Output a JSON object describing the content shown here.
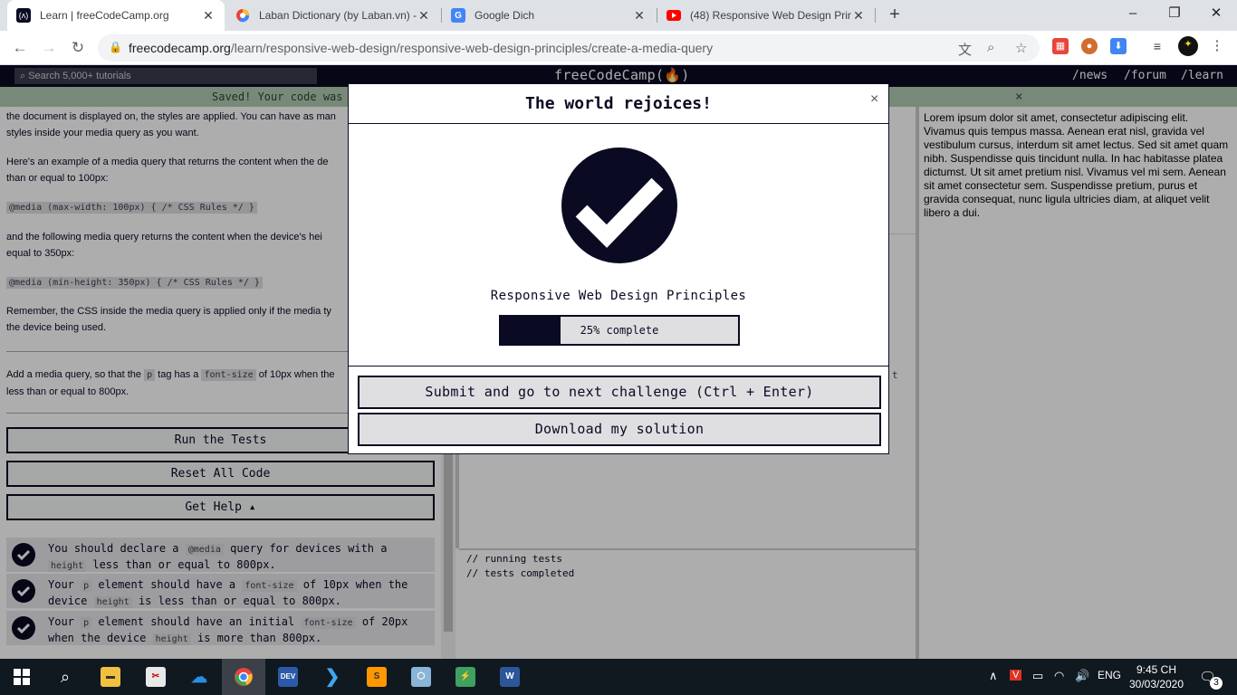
{
  "browser": {
    "tabs": [
      {
        "title": "Learn | freeCodeCamp.org",
        "close": "✕"
      },
      {
        "title": "Laban Dictionary (by Laban.vn) -",
        "close": "✕"
      },
      {
        "title": "Google Dich",
        "close": "✕"
      },
      {
        "title": "(48) Responsive Web Design Prin",
        "close": "✕"
      }
    ],
    "new_tab": "+",
    "url_host": "freecodecamp.org",
    "url_path": "/learn/responsive-web-design/responsive-web-design-principles/create-a-media-query"
  },
  "fcc_nav": {
    "search_placeholder": "Search 5,000+ tutorials",
    "logo": "freeCodeCamp(🔥)",
    "links": [
      "/news",
      "/forum",
      "/learn"
    ]
  },
  "saved_bar": {
    "text": "Saved! Your code was",
    "close": "×"
  },
  "lesson": {
    "p1": "the document is displayed on, the styles are applied. You can have as man",
    "p1b": "styles inside your media query as you want.",
    "p2": "Here's an example of a media query that returns the content when the de",
    "p2b": "than or equal to 100px:",
    "code1": "@media (max-width: 100px) { /* CSS Rules */ }",
    "p3": "and the following media query returns the content when the device's hei",
    "p3b": "equal to 350px:",
    "code2": "@media (min-height: 350px) { /* CSS Rules */ }",
    "p4": "Remember, the CSS inside the media query is applied only if the media ty",
    "p4b": "the device being used.",
    "task_a": "Add a media query, so that the",
    "task_p": "p",
    "task_b": "tag has a",
    "task_fs": "font-size",
    "task_c": "of 10px when the",
    "task_d": "less than or equal to 800px."
  },
  "buttons": {
    "run": "Run the Tests",
    "reset": "Reset All Code",
    "help": "Get Help ▴"
  },
  "tests": [
    {
      "a": "You should declare a",
      "c1": "@media",
      "b": "query for devices with a",
      "c2": "height",
      "d": "less than or equal to 800px."
    },
    {
      "a": "Your",
      "c1": "p",
      "b": "element should have a",
      "c2": "font-size",
      "e": "of 10px when the",
      "f": "device",
      "c3": "height",
      "d": "is less than or equal to 800px."
    },
    {
      "a": "Your",
      "c1": "p",
      "b": "element should have an initial",
      "c2": "font-size",
      "e": "of 20px",
      "f": "when the device",
      "c3": "height",
      "d": "is more than 800px."
    }
  ],
  "console": {
    "line1": "// running tests",
    "line2": "// tests completed"
  },
  "editor_fragment": "t",
  "preview_text": "Lorem ipsum dolor sit amet, consectetur adipiscing elit. Vivamus quis tempus massa. Aenean erat nisl, gravida vel vestibulum cursus, interdum sit amet lectus. Sed sit amet quam nibh. Suspendisse quis tincidunt nulla. In hac habitasse platea dictumst. Ut sit amet pretium nisl. Vivamus vel mi sem. Aenean sit amet consectetur sem. Suspendisse pretium, purus et gravida consequat, nunc ligula ultricies diam, at aliquet velit libero a dui.",
  "modal": {
    "title": "The world rejoices!",
    "close": "×",
    "superblock": "Responsive Web Design Principles",
    "progress_percent": 25,
    "progress_text": "25% complete",
    "submit_label": "Submit and go to next challenge (Ctrl + Enter)",
    "download_label": "Download my solution"
  },
  "taskbar": {
    "lang": "ENG",
    "time": "9:45 CH",
    "date": "30/03/2020",
    "notif_count": "3"
  },
  "colors": {
    "fcc_dark": "#0a0a23",
    "chip": "#dfdfe2",
    "saved_green": "#b3cbb3",
    "youtube_red": "#ff0000"
  }
}
